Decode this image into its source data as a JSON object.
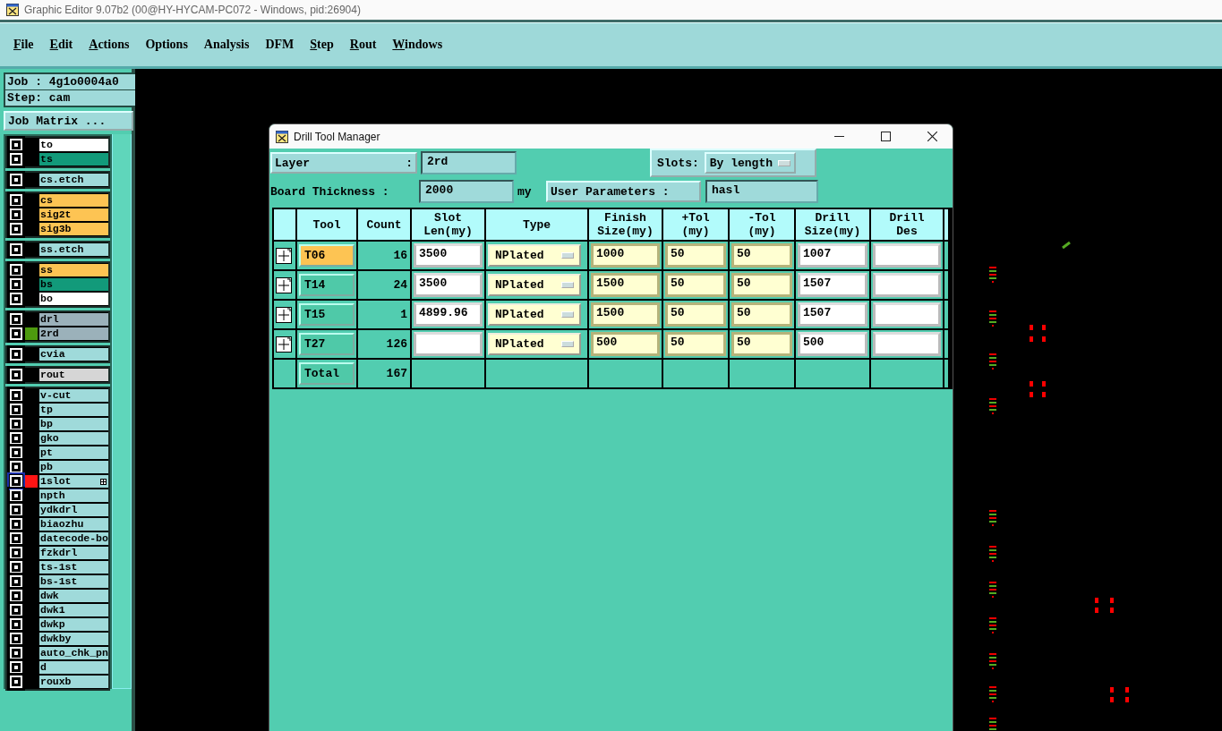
{
  "window": {
    "title": "Graphic Editor 9.07b2 (00@HY-HYCAM-PC072 - Windows, pid:26904)"
  },
  "menu": [
    {
      "label": "File",
      "mnemonic": true
    },
    {
      "label": "Edit",
      "mnemonic": true
    },
    {
      "label": "Actions",
      "mnemonic": true
    },
    {
      "label": "Options",
      "mnemonic": false
    },
    {
      "label": "Analysis",
      "mnemonic": false
    },
    {
      "label": "DFM",
      "mnemonic": false
    },
    {
      "label": "Step",
      "mnemonic": true
    },
    {
      "label": "Rout",
      "mnemonic": true
    },
    {
      "label": "Windows",
      "mnemonic": true
    }
  ],
  "job_panel": {
    "job": "Job : 4g1o0004a0",
    "step": "Step: cam",
    "matrix_button": "Job Matrix ..."
  },
  "layer_groups": [
    {
      "layers": [
        {
          "name": "to",
          "color": "#ffffff",
          "checked": true,
          "focused": false,
          "sub_icon": false
        },
        {
          "name": "ts",
          "color": "#129a7a",
          "checked": true,
          "focused": false,
          "sub_icon": false
        }
      ]
    },
    {
      "layers": [
        {
          "name": "cs.etch",
          "color": "#9fdada",
          "checked": true,
          "focused": false,
          "sub_icon": false
        }
      ]
    },
    {
      "layers": [
        {
          "name": "cs",
          "color": "#fdc453",
          "checked": true,
          "focused": false,
          "sub_icon": false
        },
        {
          "name": "sig2t",
          "color": "#fdc453",
          "checked": true,
          "focused": false,
          "sub_icon": false
        },
        {
          "name": "sig3b",
          "color": "#fdc453",
          "checked": true,
          "focused": false,
          "sub_icon": false
        }
      ]
    },
    {
      "layers": [
        {
          "name": "ss.etch",
          "color": "#9fdada",
          "checked": true,
          "focused": false,
          "sub_icon": false
        }
      ]
    },
    {
      "layers": [
        {
          "name": "ss",
          "color": "#fdc453",
          "checked": true,
          "focused": false,
          "sub_icon": false
        },
        {
          "name": "bs",
          "color": "#129a7a",
          "checked": true,
          "focused": false,
          "sub_icon": false
        },
        {
          "name": "bo",
          "color": "#ffffff",
          "checked": true,
          "focused": false,
          "sub_icon": false
        }
      ]
    },
    {
      "layers": [
        {
          "name": "drl",
          "color": "#9bb1ba",
          "checked": true,
          "focused": false,
          "sub_icon": false
        },
        {
          "name": "2rd",
          "color": "#9bb1ba",
          "swatch": {
            "color": "#4d9a0e"
          },
          "checked": true,
          "focused": false,
          "sub_icon": false
        }
      ]
    },
    {
      "layers": [
        {
          "name": "cvia",
          "color": "#9fdada",
          "checked": true,
          "focused": false,
          "sub_icon": false
        }
      ]
    },
    {
      "layers": [
        {
          "name": "rout",
          "color": "#d6d6d6",
          "checked": true,
          "focused": false,
          "sub_icon": false
        }
      ]
    },
    {
      "layers": [
        {
          "name": "v-cut",
          "color": "#9fdada",
          "checked": true,
          "focused": false,
          "sub_icon": false
        },
        {
          "name": "tp",
          "color": "#9fdada",
          "checked": true,
          "focused": false,
          "sub_icon": false
        },
        {
          "name": "bp",
          "color": "#9fdada",
          "checked": true,
          "focused": false,
          "sub_icon": false
        },
        {
          "name": "gko",
          "color": "#9fdada",
          "checked": true,
          "focused": false,
          "sub_icon": false
        },
        {
          "name": "pt",
          "color": "#9fdada",
          "checked": true,
          "focused": false,
          "sub_icon": false
        },
        {
          "name": "pb",
          "color": "#9fdada",
          "checked": true,
          "focused": false,
          "sub_icon": false
        },
        {
          "name": "1slot",
          "color": "#9fdada",
          "swatch": {
            "color": "#ff1414"
          },
          "checked": true,
          "focused": true,
          "sub_icon": true
        },
        {
          "name": "npth",
          "color": "#9fdada",
          "checked": true,
          "focused": false,
          "sub_icon": false
        },
        {
          "name": "ydkdrl",
          "color": "#9fdada",
          "checked": true,
          "focused": false,
          "sub_icon": false
        },
        {
          "name": "biaozhu",
          "color": "#9fdada",
          "checked": true,
          "focused": false,
          "sub_icon": false
        },
        {
          "name": "datecode-bo",
          "color": "#9fdada",
          "checked": true,
          "focused": false,
          "sub_icon": false
        },
        {
          "name": "fzkdrl",
          "color": "#9fdada",
          "checked": true,
          "focused": false,
          "sub_icon": false
        },
        {
          "name": "ts-1st",
          "color": "#9fdada",
          "checked": true,
          "focused": false,
          "sub_icon": false
        },
        {
          "name": "bs-1st",
          "color": "#9fdada",
          "checked": true,
          "focused": false,
          "sub_icon": false
        },
        {
          "name": "dwk",
          "color": "#9fdada",
          "checked": true,
          "focused": false,
          "sub_icon": false
        },
        {
          "name": "dwk1",
          "color": "#9fdada",
          "checked": true,
          "focused": false,
          "sub_icon": false
        },
        {
          "name": "dwkp",
          "color": "#9fdada",
          "checked": true,
          "focused": false,
          "sub_icon": false
        },
        {
          "name": "dwkby",
          "color": "#9fdada",
          "checked": true,
          "focused": false,
          "sub_icon": false
        },
        {
          "name": "auto_chk_pn",
          "color": "#9fdada",
          "checked": true,
          "focused": false,
          "sub_icon": false
        },
        {
          "name": "d",
          "color": "#9fdada",
          "checked": true,
          "focused": false,
          "sub_icon": false
        },
        {
          "name": "rouxb",
          "color": "#9fdada",
          "checked": true,
          "focused": false,
          "sub_icon": false
        }
      ]
    }
  ],
  "dialog": {
    "title": "Drill Tool Manager",
    "layer_label": "Layer",
    "layer_colon": ":",
    "layer_value": "2rd",
    "slots_label": "Slots:",
    "slots_value": "By length",
    "thickness_label": "Board Thickness :",
    "thickness_value": "2000",
    "thickness_unit": "my",
    "user_params_button": "User Parameters :",
    "user_params_value": "hasl",
    "columns": [
      "Tool",
      "Count",
      "Slot\nLen(my)",
      "Type",
      "Finish\nSize(my)",
      "+Tol\n(my)",
      "-Tol\n(my)",
      "Drill\nSize(my)",
      "Drill\nDes"
    ],
    "rows": [
      {
        "tool": "T06",
        "highlighted": true,
        "count": "16",
        "slot_len": "3500",
        "type": "NPlated",
        "finish_size": "1000",
        "plus_tol": "50",
        "minus_tol": "50",
        "drill_size": "1007"
      },
      {
        "tool": "T14",
        "highlighted": false,
        "count": "24",
        "slot_len": "3500",
        "type": "NPlated",
        "finish_size": "1500",
        "plus_tol": "50",
        "minus_tol": "50",
        "drill_size": "1507"
      },
      {
        "tool": "T15",
        "highlighted": false,
        "count": "1",
        "slot_len": "4899.96",
        "type": "NPlated",
        "finish_size": "1500",
        "plus_tol": "50",
        "minus_tol": "50",
        "drill_size": "1507"
      },
      {
        "tool": "T27",
        "highlighted": false,
        "count": "126",
        "type": "NPlated",
        "finish_size": "500",
        "plus_tol": "50",
        "minus_tol": "50",
        "drill_size": "500"
      }
    ],
    "total": {
      "label": "Total",
      "count": "167"
    }
  }
}
